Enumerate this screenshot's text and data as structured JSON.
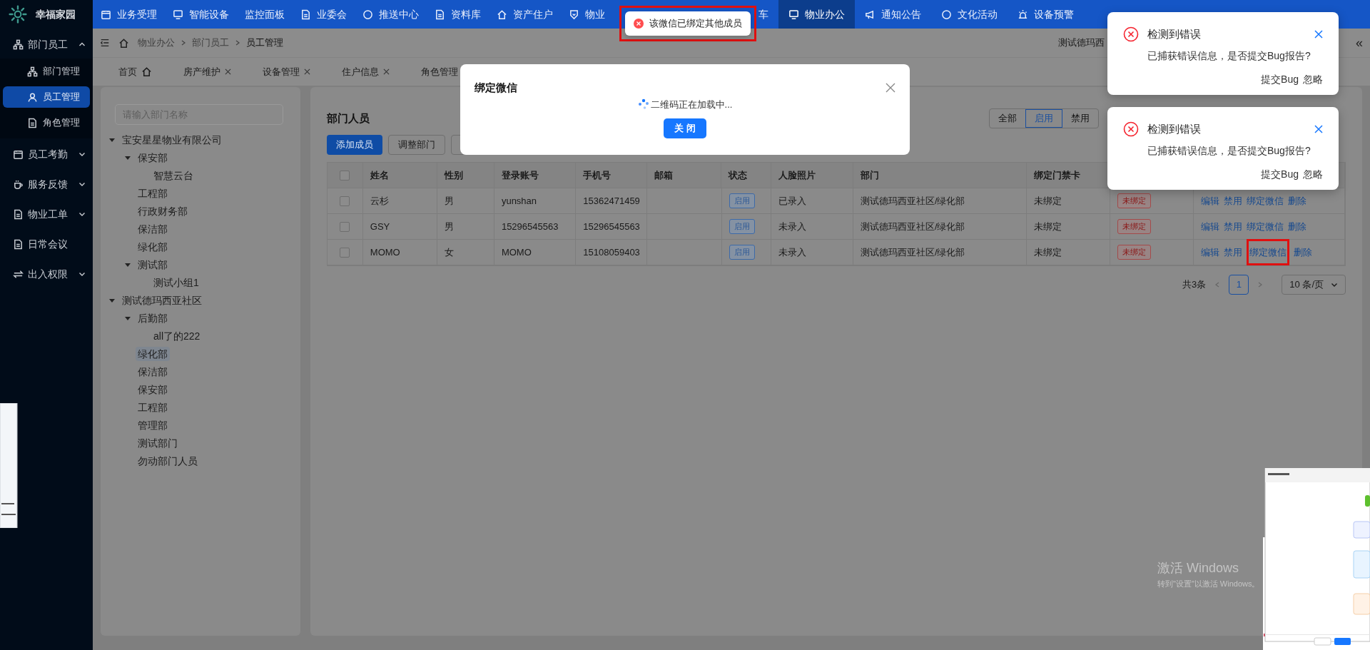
{
  "app": {
    "title": "幸福家园"
  },
  "sidebar": {
    "items": [
      {
        "label": "部门员工",
        "expanded": true,
        "children": [
          {
            "label": "部门管理",
            "selected": false
          },
          {
            "label": "员工管理",
            "selected": true
          },
          {
            "label": "角色管理",
            "selected": false
          }
        ]
      },
      {
        "label": "员工考勤",
        "expanded": false
      },
      {
        "label": "服务反馈",
        "expanded": false
      },
      {
        "label": "物业工单",
        "expanded": false
      },
      {
        "label": "日常会议"
      },
      {
        "label": "出入权限",
        "expanded": false
      }
    ]
  },
  "topnav": {
    "items_before_message": [
      {
        "label": "业务受理",
        "selected": false
      },
      {
        "label": "智能设备",
        "selected": false
      },
      {
        "label": "监控面板",
        "selected": false
      },
      {
        "label": "业委会",
        "selected": false
      },
      {
        "label": "推送中心",
        "selected": false
      },
      {
        "label": "资料库",
        "selected": false
      },
      {
        "label": "资产住户",
        "selected": false
      },
      {
        "label": "物业",
        "selected": false
      }
    ],
    "items_after_message": [
      {
        "label": "车",
        "selected": false
      },
      {
        "label": "物业办公",
        "selected": true
      },
      {
        "label": "通知公告",
        "selected": false
      },
      {
        "label": "文化活动",
        "selected": false
      },
      {
        "label": "设备预警",
        "selected": false
      }
    ]
  },
  "breadcrumb": [
    "物业办公",
    "部门员工",
    "员工管理"
  ],
  "account": "测试德玛西",
  "collapse": "«",
  "page_tabs": [
    {
      "label": "首页",
      "kind": "home",
      "selected": false
    },
    {
      "label": "房产维护",
      "kind": "closable",
      "selected": false
    },
    {
      "label": "设备管理",
      "kind": "closable",
      "selected": false
    },
    {
      "label": "住户信息",
      "kind": "closable",
      "selected": false
    },
    {
      "label": "角色管理",
      "kind": "label_only",
      "selected": false
    }
  ],
  "tree": {
    "placeholder": "请输入部门名称",
    "nodes": [
      {
        "label": "宝安星星物业有限公司",
        "expanded": true,
        "selected": false,
        "children": [
          {
            "label": "保安部",
            "expanded": true,
            "selected": false,
            "children": [
              {
                "label": "智慧云台",
                "selected": false
              }
            ]
          },
          {
            "label": "工程部",
            "selected": false
          },
          {
            "label": "行政财务部",
            "selected": false
          },
          {
            "label": "保洁部",
            "selected": false
          },
          {
            "label": "绿化部",
            "selected": false
          },
          {
            "label": "测试部",
            "expanded": true,
            "selected": false,
            "children": [
              {
                "label": "测试小组1",
                "selected": false
              }
            ]
          }
        ]
      },
      {
        "label": "测试德玛西亚社区",
        "expanded": true,
        "selected": false,
        "children": [
          {
            "label": "后勤部",
            "expanded": true,
            "selected": false,
            "children": [
              {
                "label": "all了的222",
                "selected": false
              }
            ]
          },
          {
            "label": "绿化部",
            "selected": true
          },
          {
            "label": "保洁部",
            "selected": false
          },
          {
            "label": "保安部",
            "selected": false
          },
          {
            "label": "工程部",
            "selected": false
          },
          {
            "label": "管理部",
            "selected": false
          },
          {
            "label": "测试部门",
            "selected": false
          },
          {
            "label": "勿动部门人员",
            "selected": false
          }
        ]
      }
    ]
  },
  "members": {
    "title": "部门人员",
    "buttons": [
      {
        "label": "添加成员",
        "kind": "primary"
      },
      {
        "label": "调整部门",
        "kind": "default"
      },
      {
        "kind": "default"
      }
    ],
    "filter": [
      {
        "label": "全部",
        "selected": false
      },
      {
        "label": "启用",
        "selected": true
      },
      {
        "label": "禁用",
        "selected": false
      }
    ],
    "table": {
      "all_checked": false,
      "columns": [
        "姓名",
        "性别",
        "登录账号",
        "手机号",
        "邮箱",
        "状态",
        "人脸照片",
        "部门",
        "绑定门禁卡"
      ],
      "rows": [
        {
          "checked": false,
          "name": "云杉",
          "gender": "男",
          "account": "yunshan",
          "phone": "15362471459",
          "status": "启用",
          "face": "已录入",
          "department": "测试德玛西亚社区/绿化部",
          "card": "未绑定",
          "column_11": "未绑定",
          "actions": [
            {
              "label": "编辑",
              "highlighted": false
            },
            {
              "label": "禁用",
              "highlighted": false
            },
            {
              "label": "绑定微信",
              "highlighted": false
            },
            {
              "label": "删除",
              "highlighted": false
            }
          ]
        },
        {
          "checked": false,
          "name": "GSY",
          "gender": "男",
          "account": "15296545563",
          "phone": "15296545563",
          "status": "启用",
          "face": "未录入",
          "department": "测试德玛西亚社区/绿化部",
          "card": "未绑定",
          "column_11": "未绑定",
          "actions": [
            {
              "label": "编辑",
              "highlighted": false
            },
            {
              "label": "禁用",
              "highlighted": false
            },
            {
              "label": "绑定微信",
              "highlighted": false
            },
            {
              "label": "删除",
              "highlighted": false
            }
          ]
        },
        {
          "checked": false,
          "name": "MOMO",
          "gender": "女",
          "account": "MOMO",
          "phone": "15108059403",
          "status": "启用",
          "face": "未录入",
          "department": "测试德玛西亚社区/绿化部",
          "card": "未绑定",
          "column_11": "未绑定",
          "actions": [
            {
              "label": "编辑",
              "highlighted": false
            },
            {
              "label": "禁用",
              "highlighted": false
            },
            {
              "label": "绑定微信",
              "highlighted": true
            },
            {
              "label": "删除",
              "highlighted": false
            }
          ]
        }
      ]
    },
    "pagination": {
      "total": "共3条",
      "pages": [
        {
          "label": "1",
          "selected": true
        }
      ],
      "page_size": "10 条/页"
    }
  },
  "dialog": {
    "title": "绑定微信",
    "message": "二维码正在加载中...",
    "button": "关 闭"
  },
  "message": {
    "text": "该微信已绑定其他成员",
    "highlighted": true
  },
  "notifications": [
    {
      "title": "检测到错误",
      "body": "已捕获错误信息，是否提交Bug报告?",
      "actions": [
        "提交Bug",
        "忽略"
      ]
    },
    {
      "title": "检测到错误",
      "body": "已捕获错误信息，是否提交Bug报告?",
      "actions": [
        "提交Bug",
        "忽略"
      ]
    }
  ],
  "os_notice": {
    "title": "激活 Windows",
    "body": "转到\"设置\"以激活 Windows。"
  }
}
